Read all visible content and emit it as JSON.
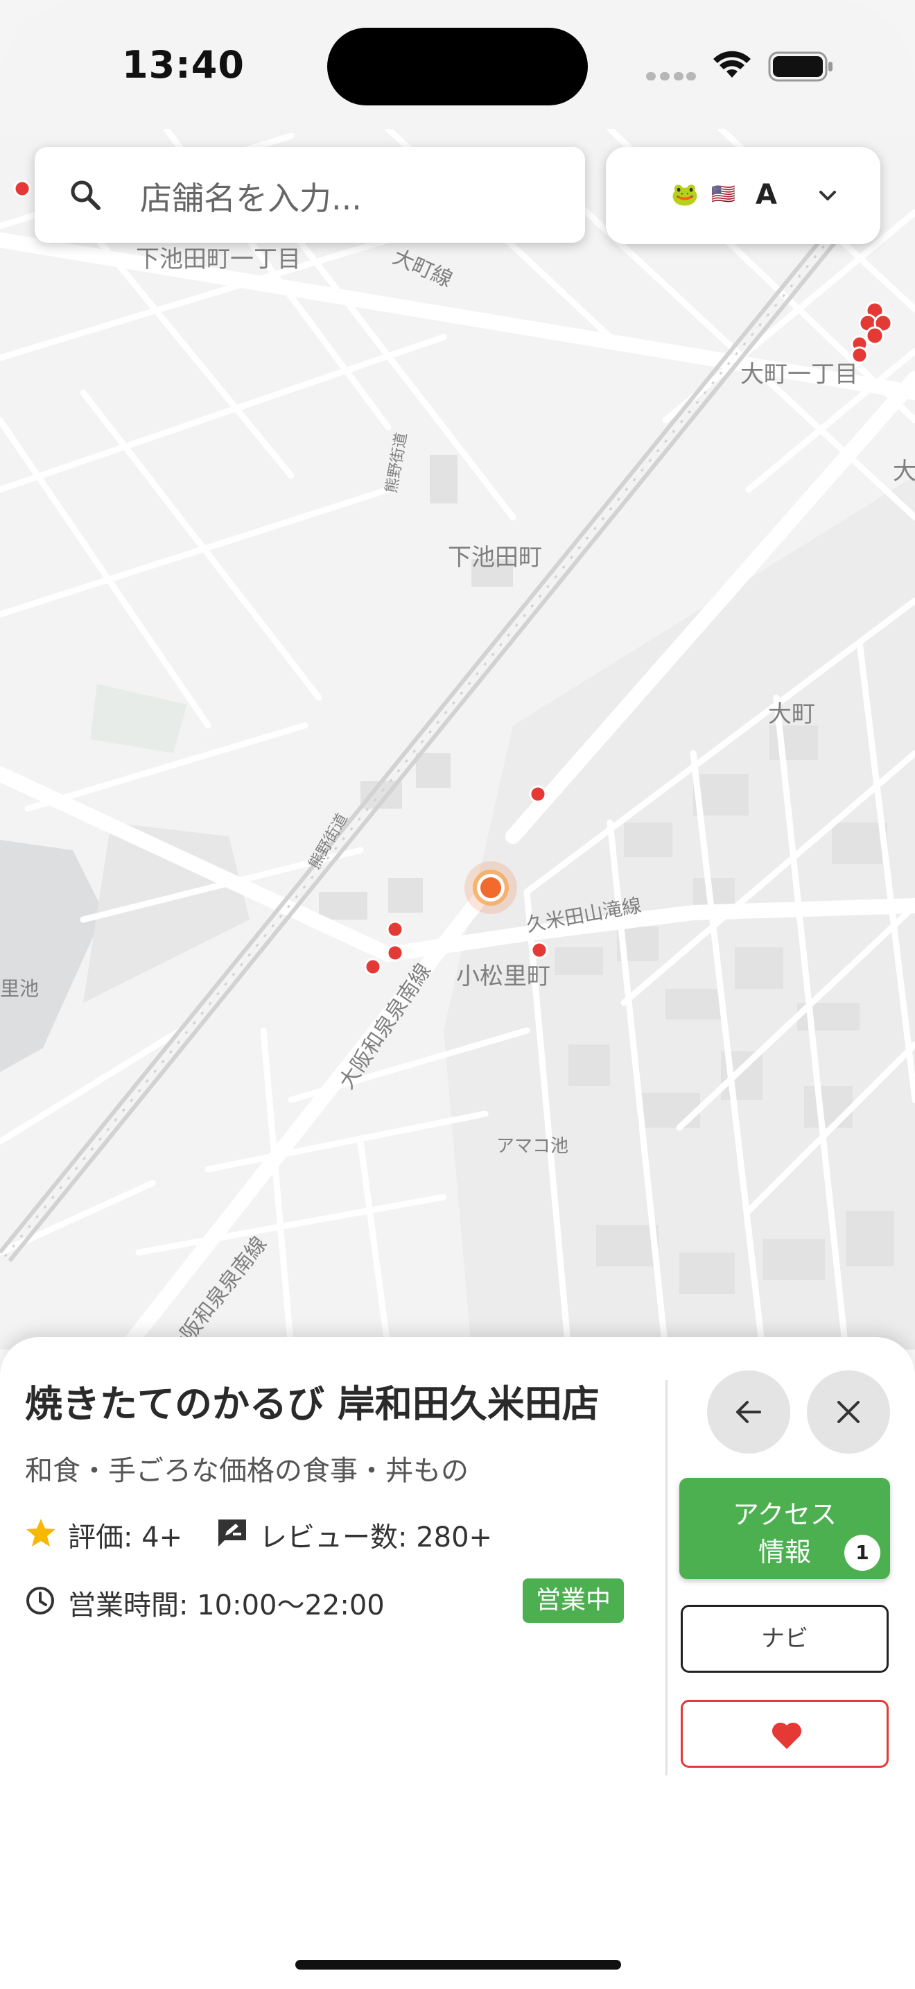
{
  "status_bar": {
    "time": "13:40"
  },
  "search": {
    "placeholder": "店舗名を入力..."
  },
  "language": {
    "flag_1": "🐸",
    "flag_2": "🇺🇸",
    "letter": "A"
  },
  "map": {
    "labels": [
      "下池田町一丁目",
      "大町線",
      "大町一丁目",
      "大",
      "下池田町",
      "大町",
      "久米田山滝線",
      "小松里町",
      "里池",
      "アマコ池",
      "大阪和泉泉南線",
      "大阪和泉泉南線",
      "熊野街道",
      "熊野街道"
    ]
  },
  "shop": {
    "name": "焼きたてのかるび 岸和田久米田店",
    "category": "和食・手ごろな価格の食事・丼もの",
    "rating": "評価: 4+",
    "reviews": "レビュー数: 280+",
    "hours": "営業時間: 10:00〜22:00",
    "status": "営業中"
  },
  "actions": {
    "access_line_1": "アクセス",
    "access_line_2": "情報",
    "access_count": "1",
    "navi": "ナビ"
  },
  "colors": {
    "accent_green": "#4caf50",
    "marker_red": "#e53935",
    "location_orange": "#f26b2d"
  }
}
